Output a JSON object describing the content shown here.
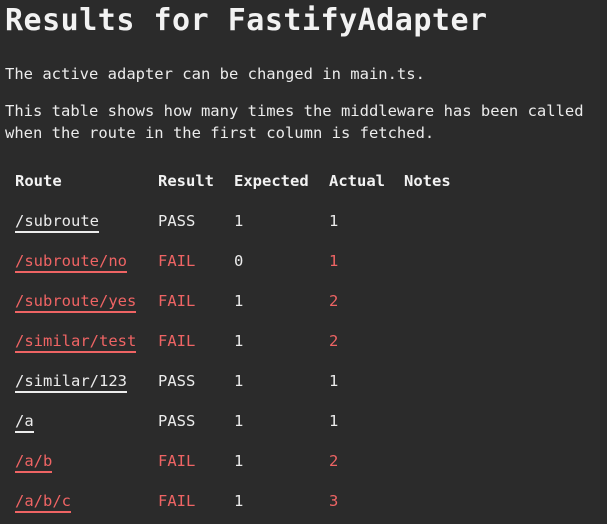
{
  "title": "Results for FastifyAdapter",
  "intro": "The active adapter can be changed in main.ts.",
  "description_line1": "This table shows how many times the middleware has been called",
  "description_line2": "when the route in the first column is fetched.",
  "table": {
    "headers": [
      "Route",
      "Result",
      "Expected",
      "Actual",
      "Notes"
    ],
    "rows": [
      {
        "route": "/subroute",
        "result": "PASS",
        "expected": "1",
        "actual": "1",
        "notes": ""
      },
      {
        "route": "/subroute/no",
        "result": "FAIL",
        "expected": "0",
        "actual": "1",
        "notes": ""
      },
      {
        "route": "/subroute/yes",
        "result": "FAIL",
        "expected": "1",
        "actual": "2",
        "notes": ""
      },
      {
        "route": "/similar/test",
        "result": "FAIL",
        "expected": "1",
        "actual": "2",
        "notes": ""
      },
      {
        "route": "/similar/123",
        "result": "PASS",
        "expected": "1",
        "actual": "1",
        "notes": ""
      },
      {
        "route": "/a",
        "result": "PASS",
        "expected": "1",
        "actual": "1",
        "notes": ""
      },
      {
        "route": "/a/b",
        "result": "FAIL",
        "expected": "1",
        "actual": "2",
        "notes": ""
      },
      {
        "route": "/a/b/c",
        "result": "FAIL",
        "expected": "1",
        "actual": "3",
        "notes": ""
      }
    ]
  },
  "colors": {
    "background": "#2b2b2b",
    "text": "#ececec",
    "fail": "#ef6464"
  }
}
